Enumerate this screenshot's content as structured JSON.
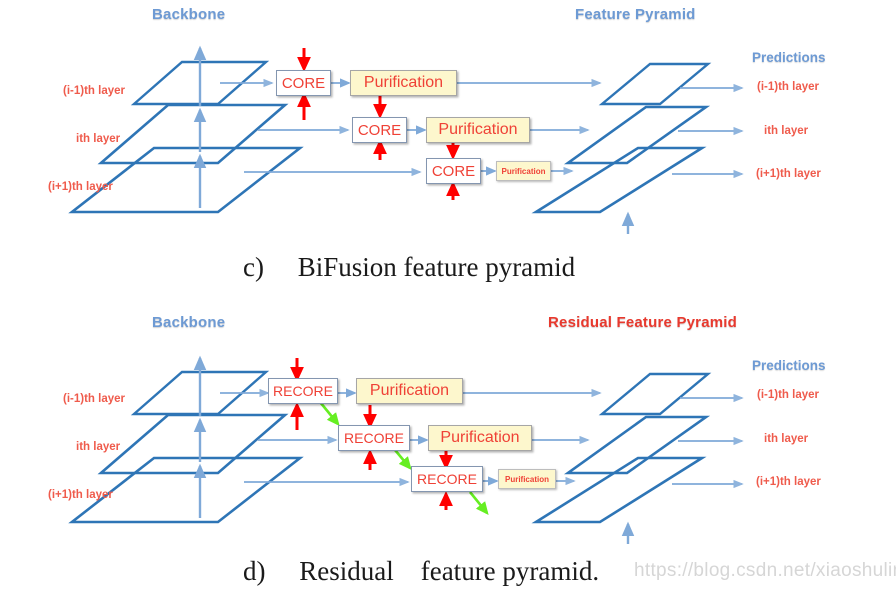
{
  "figure": {
    "watermark": "https://blog.csdn.net/xiaoshulinlove"
  },
  "colors": {
    "backbone_blue": "#2e75b6",
    "arrow_blue": "#7fa9d8",
    "arrow_red": "#ff0000",
    "arrow_green": "#66ee22",
    "header_blue": "#6d9ad4",
    "header_red": "#e8392e",
    "label_red": "#ef5b4c",
    "box_fill_yellow": "#fdf7cd",
    "box_fill_white": "#ffffff",
    "box_text_red": "#ef4136"
  },
  "panels": [
    {
      "id": "bifusion",
      "caption": "c)     BiFusion feature pyramid",
      "headers": {
        "backbone": "Backbone",
        "pyramid": "Feature Pyramid",
        "pyramid_style": "blue",
        "predictions": "Predictions"
      },
      "backbone_labels": [
        "(i-1)th layer",
        "ith layer",
        "(i+1)th layer"
      ],
      "prediction_labels": [
        "(i-1)th layer",
        "ith layer",
        "(i+1)th layer"
      ],
      "core_boxes": [
        {
          "label": "CORE"
        },
        {
          "label": "CORE"
        },
        {
          "label": "CORE"
        }
      ],
      "purification_boxes": [
        {
          "label": "Purification",
          "size": "large"
        },
        {
          "label": "Purification",
          "size": "large"
        },
        {
          "label": "Purification",
          "size": "small"
        }
      ],
      "has_green_arrows": false
    },
    {
      "id": "residual",
      "caption": "d)     Residual    feature pyramid.",
      "headers": {
        "backbone": "Backbone",
        "pyramid": "Residual Feature Pyramid",
        "pyramid_style": "red",
        "predictions": "Predictions"
      },
      "backbone_labels": [
        "(i-1)th layer",
        "ith layer",
        "(i+1)th layer"
      ],
      "prediction_labels": [
        "(i-1)th layer",
        "ith layer",
        "(i+1)th layer"
      ],
      "core_boxes": [
        {
          "label": "RECORE"
        },
        {
          "label": "RECORE"
        },
        {
          "label": "RECORE"
        }
      ],
      "purification_boxes": [
        {
          "label": "Purification",
          "size": "large"
        },
        {
          "label": "Purification",
          "size": "large"
        },
        {
          "label": "Purification",
          "size": "small"
        }
      ],
      "has_green_arrows": true
    }
  ]
}
